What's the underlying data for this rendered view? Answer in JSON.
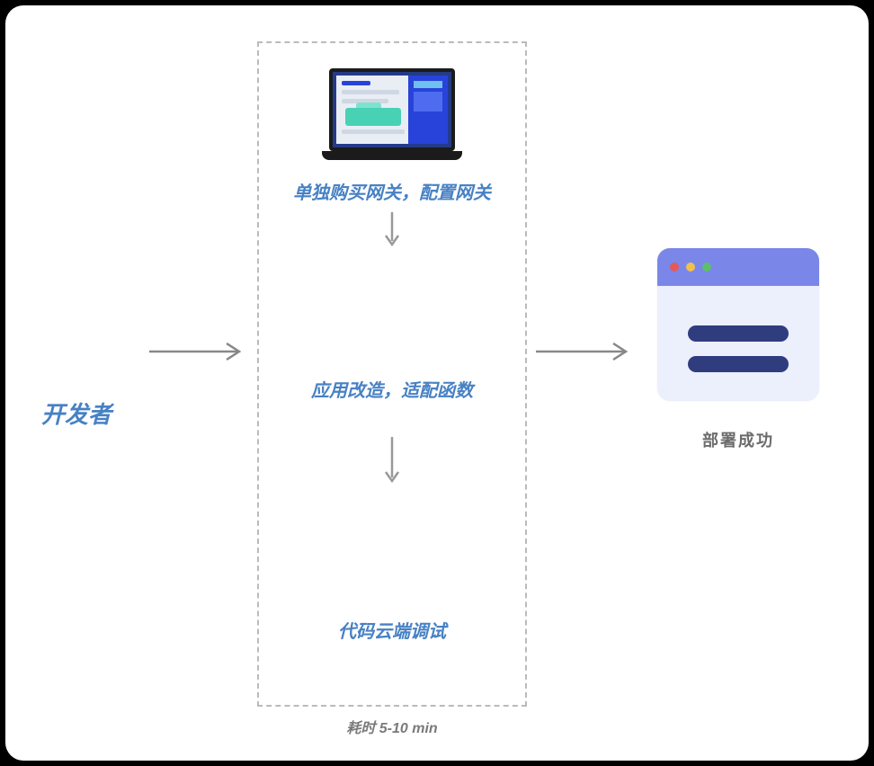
{
  "developer_label": "开发者",
  "steps": {
    "step1": "单独购买网关，配置网关",
    "step2": "应用改造，适配函数",
    "step3": "代码云端调试"
  },
  "time_label": "耗时 5-10 min",
  "success_label": "部署成功"
}
